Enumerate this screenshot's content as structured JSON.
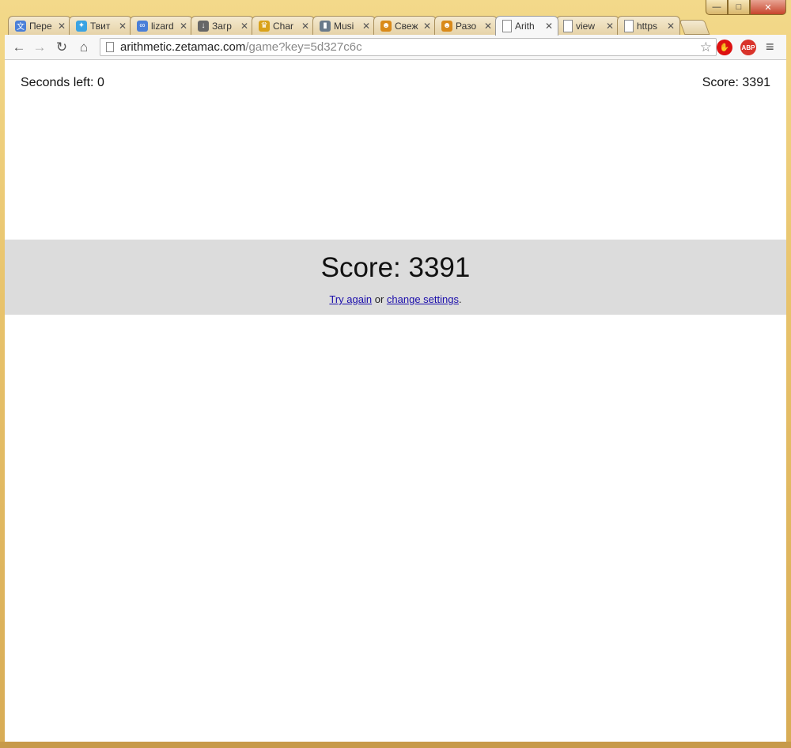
{
  "window": {
    "controls": {
      "minimize": "—",
      "maximize": "□",
      "close": "✕"
    }
  },
  "tabs": [
    {
      "label": "Пере",
      "icon": "translate-icon",
      "icon_color": "#4a7fd8",
      "glyph": "文"
    },
    {
      "label": "Твит",
      "icon": "twitter-icon",
      "icon_color": "#3aa3e3",
      "glyph": "✦"
    },
    {
      "label": "lizard",
      "icon": "link-icon",
      "icon_color": "#4a7fd8",
      "glyph": "∞"
    },
    {
      "label": "Загр",
      "icon": "download-icon",
      "icon_color": "#666666",
      "glyph": "↓"
    },
    {
      "label": "Char",
      "icon": "crown-icon",
      "icon_color": "#d9a21a",
      "glyph": "♛"
    },
    {
      "label": "Musi",
      "icon": "music-icon",
      "icon_color": "#6a7a8a",
      "glyph": "▮"
    },
    {
      "label": "Свеж",
      "icon": "face-icon",
      "icon_color": "#d98a1a",
      "glyph": "☻"
    },
    {
      "label": "Разо",
      "icon": "face-icon",
      "icon_color": "#d98a1a",
      "glyph": "☻"
    },
    {
      "label": "Arith",
      "icon": "page-icon",
      "icon_color": "#ffffff",
      "glyph": "",
      "active": true
    },
    {
      "label": "view",
      "icon": "page-icon",
      "icon_color": "#ffffff",
      "glyph": ""
    },
    {
      "label": "https",
      "icon": "page-icon",
      "icon_color": "#ffffff",
      "glyph": ""
    }
  ],
  "toolbar": {
    "back": "←",
    "forward": "→",
    "reload": "↻",
    "home": "⌂",
    "url_host": "arithmetic.zetamac.com",
    "url_path": "/game?key=5d327c6c",
    "star": "☆",
    "ext_stop": "✋",
    "ext_abp": "ABP",
    "menu": "≡"
  },
  "game": {
    "seconds_left": "Seconds left: 0",
    "score_top": "Score: 3391",
    "final_score": "Score: 3391",
    "try_again": "Try again",
    "or_text": " or ",
    "change_settings": "change settings",
    "period": "."
  }
}
